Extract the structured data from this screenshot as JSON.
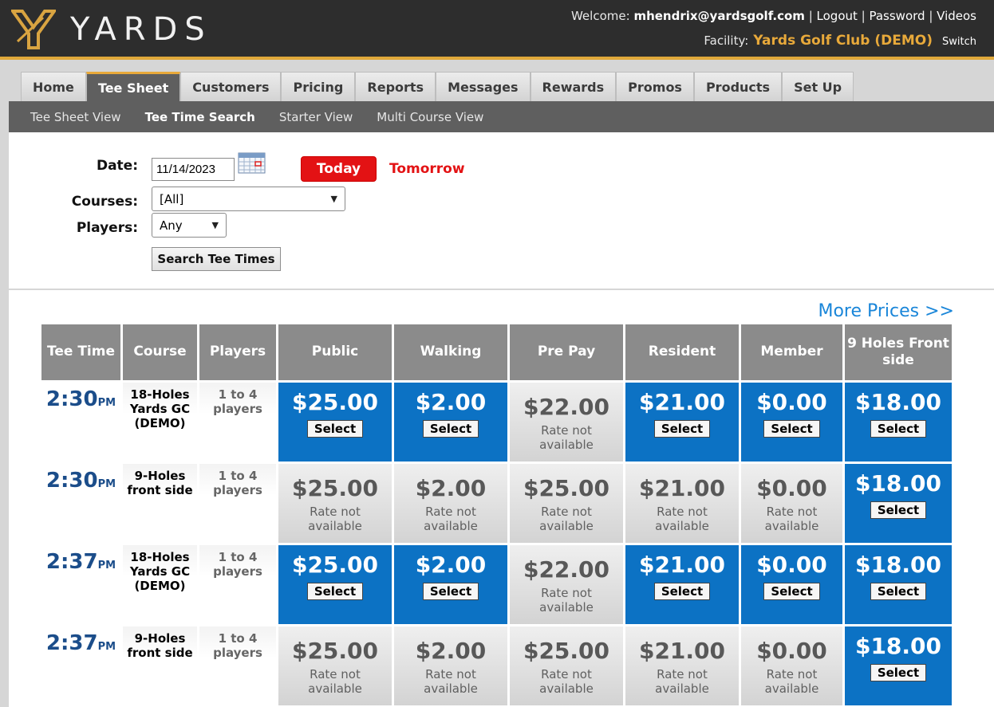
{
  "brand": {
    "name": "YARDS"
  },
  "header": {
    "welcome_label": "Welcome:",
    "user": "mhendrix@yardsgolf.com",
    "links": [
      "Logout",
      "Password",
      "Videos"
    ],
    "facility_label": "Facility:",
    "facility_name": "Yards Golf Club (DEMO)",
    "switch_label": "Switch"
  },
  "tabs": [
    {
      "label": "Home",
      "active": false
    },
    {
      "label": "Tee Sheet",
      "active": true
    },
    {
      "label": "Customers",
      "active": false
    },
    {
      "label": "Pricing",
      "active": false
    },
    {
      "label": "Reports",
      "active": false
    },
    {
      "label": "Messages",
      "active": false
    },
    {
      "label": "Rewards",
      "active": false
    },
    {
      "label": "Promos",
      "active": false
    },
    {
      "label": "Products",
      "active": false
    },
    {
      "label": "Set Up",
      "active": false
    }
  ],
  "subnav": [
    {
      "label": "Tee Sheet View",
      "active": false
    },
    {
      "label": "Tee Time Search",
      "active": true
    },
    {
      "label": "Starter View",
      "active": false
    },
    {
      "label": "Multi Course View",
      "active": false
    }
  ],
  "search": {
    "date_label": "Date:",
    "date_value": "11/14/2023",
    "today_label": "Today",
    "tomorrow_label": "Tomorrow",
    "courses_label": "Courses:",
    "courses_value": "[All]",
    "players_label": "Players:",
    "players_value": "Any",
    "search_button": "Search Tee Times"
  },
  "results": {
    "more_prices": "More Prices >>",
    "columns": [
      "Tee Time",
      "Course",
      "Players",
      "Public",
      "Walking",
      "Pre Pay",
      "Resident",
      "Member",
      "9 Holes Front side"
    ],
    "select_label": "Select",
    "na_label_1": "Rate not",
    "na_label_2": "available",
    "rows": [
      {
        "time": "2:30",
        "ampm": "PM",
        "course": [
          "18-Holes",
          "Yards GC",
          "(DEMO)"
        ],
        "players": [
          "1 to 4",
          "players"
        ],
        "prices": [
          {
            "v": "$25.00",
            "ok": true
          },
          {
            "v": "$2.00",
            "ok": true
          },
          {
            "v": "$22.00",
            "ok": false
          },
          {
            "v": "$21.00",
            "ok": true
          },
          {
            "v": "$0.00",
            "ok": true
          },
          {
            "v": "$18.00",
            "ok": true
          }
        ]
      },
      {
        "time": "2:30",
        "ampm": "PM",
        "course": [
          "9-Holes",
          "front side"
        ],
        "players": [
          "1 to 4",
          "players"
        ],
        "prices": [
          {
            "v": "$25.00",
            "ok": false
          },
          {
            "v": "$2.00",
            "ok": false
          },
          {
            "v": "$25.00",
            "ok": false
          },
          {
            "v": "$21.00",
            "ok": false
          },
          {
            "v": "$0.00",
            "ok": false
          },
          {
            "v": "$18.00",
            "ok": true
          }
        ]
      },
      {
        "time": "2:37",
        "ampm": "PM",
        "course": [
          "18-Holes",
          "Yards GC",
          "(DEMO)"
        ],
        "players": [
          "1 to 4",
          "players"
        ],
        "prices": [
          {
            "v": "$25.00",
            "ok": true
          },
          {
            "v": "$2.00",
            "ok": true
          },
          {
            "v": "$22.00",
            "ok": false
          },
          {
            "v": "$21.00",
            "ok": true
          },
          {
            "v": "$0.00",
            "ok": true
          },
          {
            "v": "$18.00",
            "ok": true
          }
        ]
      },
      {
        "time": "2:37",
        "ampm": "PM",
        "course": [
          "9-Holes",
          "front side"
        ],
        "players": [
          "1 to 4",
          "players"
        ],
        "prices": [
          {
            "v": "$25.00",
            "ok": false
          },
          {
            "v": "$2.00",
            "ok": false
          },
          {
            "v": "$25.00",
            "ok": false
          },
          {
            "v": "$21.00",
            "ok": false
          },
          {
            "v": "$0.00",
            "ok": false
          },
          {
            "v": "$18.00",
            "ok": true
          }
        ]
      }
    ]
  },
  "colors": {
    "accent": "#e8a93a",
    "header_bg": "#2d2d2d",
    "rate_blue": "#0c72c4",
    "today_red": "#e31214",
    "time_blue": "#1b4d8a"
  }
}
